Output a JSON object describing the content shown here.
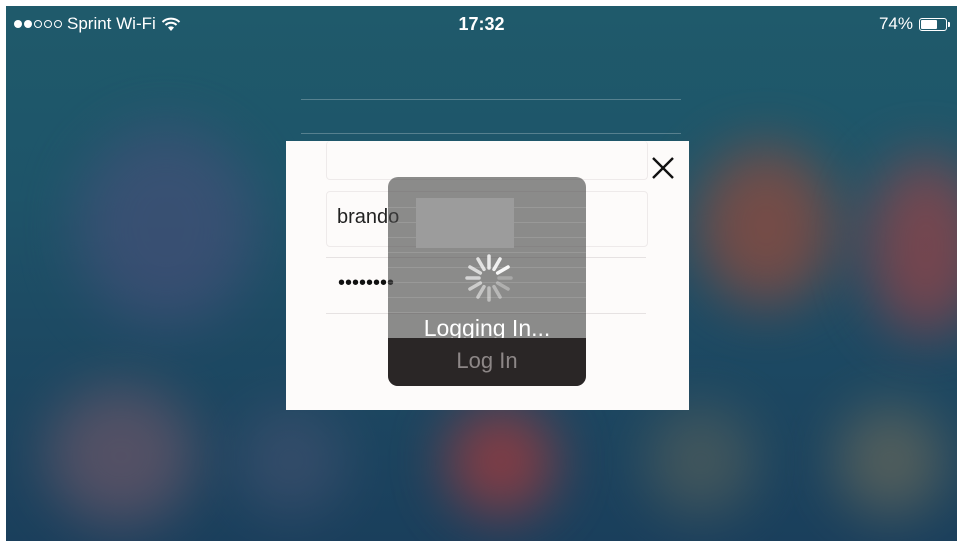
{
  "status_bar": {
    "carrier": "Sprint Wi-Fi",
    "time": "17:32",
    "battery_percent": "74%",
    "battery_level": 0.74,
    "signal_bars_filled": 2,
    "signal_bars_total": 5,
    "wifi_icon": "wifi-icon",
    "battery_icon": "battery-icon"
  },
  "login_dialog": {
    "close_icon": "close-icon",
    "username_value": "brando",
    "password_masked": "••••••••",
    "login_button_label": "Log In"
  },
  "progress_hud": {
    "label": "Logging In...",
    "spinner_icon": "spinner-icon"
  },
  "colors": {
    "modal_background": "#fdfbfa",
    "hud_background": "#464646",
    "button_background": "#2a2626",
    "button_text": "#8d8787"
  }
}
